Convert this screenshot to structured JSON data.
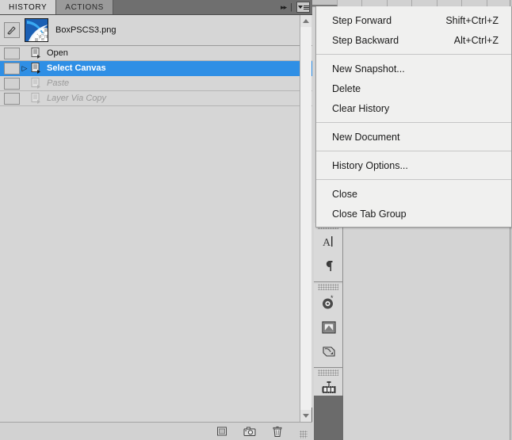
{
  "panel": {
    "tabs": [
      {
        "label": "HISTORY",
        "active": true
      },
      {
        "label": "ACTIONS",
        "active": false
      }
    ],
    "collapse_icon": "double-chevron-right-icon",
    "menu_icon": "panel-menu-icon",
    "snapshot": {
      "name": "BoxPSCS3.png",
      "brush_icon": "history-brush-icon",
      "thumbnail_icon": "document-thumbnail"
    },
    "history_items": [
      {
        "label": "Open",
        "state": "normal",
        "marker": "",
        "icon": "history-state-icon"
      },
      {
        "label": "Select Canvas",
        "state": "selected",
        "marker": "▷",
        "icon": "history-state-icon"
      },
      {
        "label": "Paste",
        "state": "disabled",
        "marker": "",
        "icon": "history-state-icon"
      },
      {
        "label": "Layer Via Copy",
        "state": "disabled",
        "marker": "",
        "icon": "history-state-icon"
      }
    ],
    "bottom_buttons": [
      {
        "name": "new-document-from-state-button",
        "icon": "document-icon"
      },
      {
        "name": "new-snapshot-button",
        "icon": "camera-icon"
      },
      {
        "name": "delete-state-button",
        "icon": "trash-icon"
      }
    ],
    "scrollbar": {
      "up_arrow": "scroll-up-arrow",
      "down_arrow": "scroll-down-arrow"
    }
  },
  "menu": {
    "groups": [
      {
        "items": [
          {
            "label": "Step Forward",
            "shortcut": "Shift+Ctrl+Z"
          },
          {
            "label": "Step Backward",
            "shortcut": "Alt+Ctrl+Z"
          }
        ]
      },
      {
        "items": [
          {
            "label": "New Snapshot...",
            "shortcut": ""
          },
          {
            "label": "Delete",
            "shortcut": ""
          },
          {
            "label": "Clear History",
            "shortcut": ""
          }
        ]
      },
      {
        "items": [
          {
            "label": "New Document",
            "shortcut": ""
          }
        ]
      },
      {
        "items": [
          {
            "label": "History Options...",
            "shortcut": ""
          }
        ]
      },
      {
        "items": [
          {
            "label": "Close",
            "shortcut": ""
          },
          {
            "label": "Close Tab Group",
            "shortcut": ""
          }
        ]
      }
    ]
  },
  "dock": {
    "groups": [
      {
        "buttons": [
          {
            "name": "character-panel-icon",
            "icon": "character-icon"
          },
          {
            "name": "paragraph-panel-icon",
            "icon": "paragraph-icon"
          }
        ]
      },
      {
        "buttons": [
          {
            "name": "color-panel-icon",
            "icon": "target-swatch-icon"
          },
          {
            "name": "navigator-panel-icon",
            "icon": "navigator-icon"
          },
          {
            "name": "histogram-panel-icon",
            "icon": "histogram-icon"
          }
        ]
      },
      {
        "buttons": [
          {
            "name": "animation-panel-icon",
            "icon": "film-strip-icon"
          },
          {
            "name": "timeline-panel-icon",
            "icon": "timeline-icon"
          }
        ]
      }
    ]
  },
  "colors": {
    "selection_blue": "#2f8fe5",
    "panel_bg": "#d6d6d6",
    "menu_bg": "#f0f0ef",
    "tab_bar": "#6f6f6f",
    "dock_fill": "#6b6b6b"
  }
}
